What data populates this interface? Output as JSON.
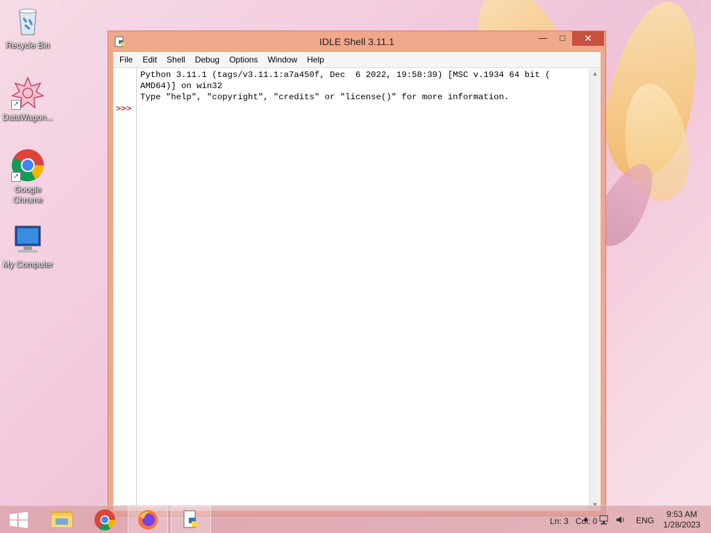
{
  "desktop": {
    "icons": [
      {
        "label": "Recycle Bin",
        "icon": "recycle-bin-icon"
      },
      {
        "label": "DataWagon...",
        "icon": "datawagon-icon"
      },
      {
        "label": "Google Chrome",
        "icon": "chrome-icon"
      },
      {
        "label": "My Computer",
        "icon": "computer-icon"
      }
    ]
  },
  "window": {
    "title": "IDLE Shell 3.11.1",
    "controls": {
      "minimize": "—",
      "maximize": "□",
      "close": "✕"
    },
    "menu": [
      "File",
      "Edit",
      "Shell",
      "Debug",
      "Options",
      "Window",
      "Help"
    ],
    "shell_lines": [
      "Python 3.11.1 (tags/v3.11.1:a7a450f, Dec  6 2022, 19:58:39) [MSC v.1934 64 bit (",
      "AMD64)] on win32",
      "Type \"help\", \"copyright\", \"credits\" or \"license()\" for more information."
    ],
    "prompt": ">>>",
    "status": {
      "line": "Ln: 3",
      "col": "Col: 0"
    }
  },
  "taskbar": {
    "items": [
      "start-button",
      "file-explorer",
      "chrome",
      "firefox",
      "idle"
    ],
    "language": "ENG",
    "time": "9:53 AM",
    "date": "1/28/2023"
  },
  "colors": {
    "window_frame": "#f0a88b",
    "close_button": "#c7503f",
    "prompt": "#c00000"
  }
}
